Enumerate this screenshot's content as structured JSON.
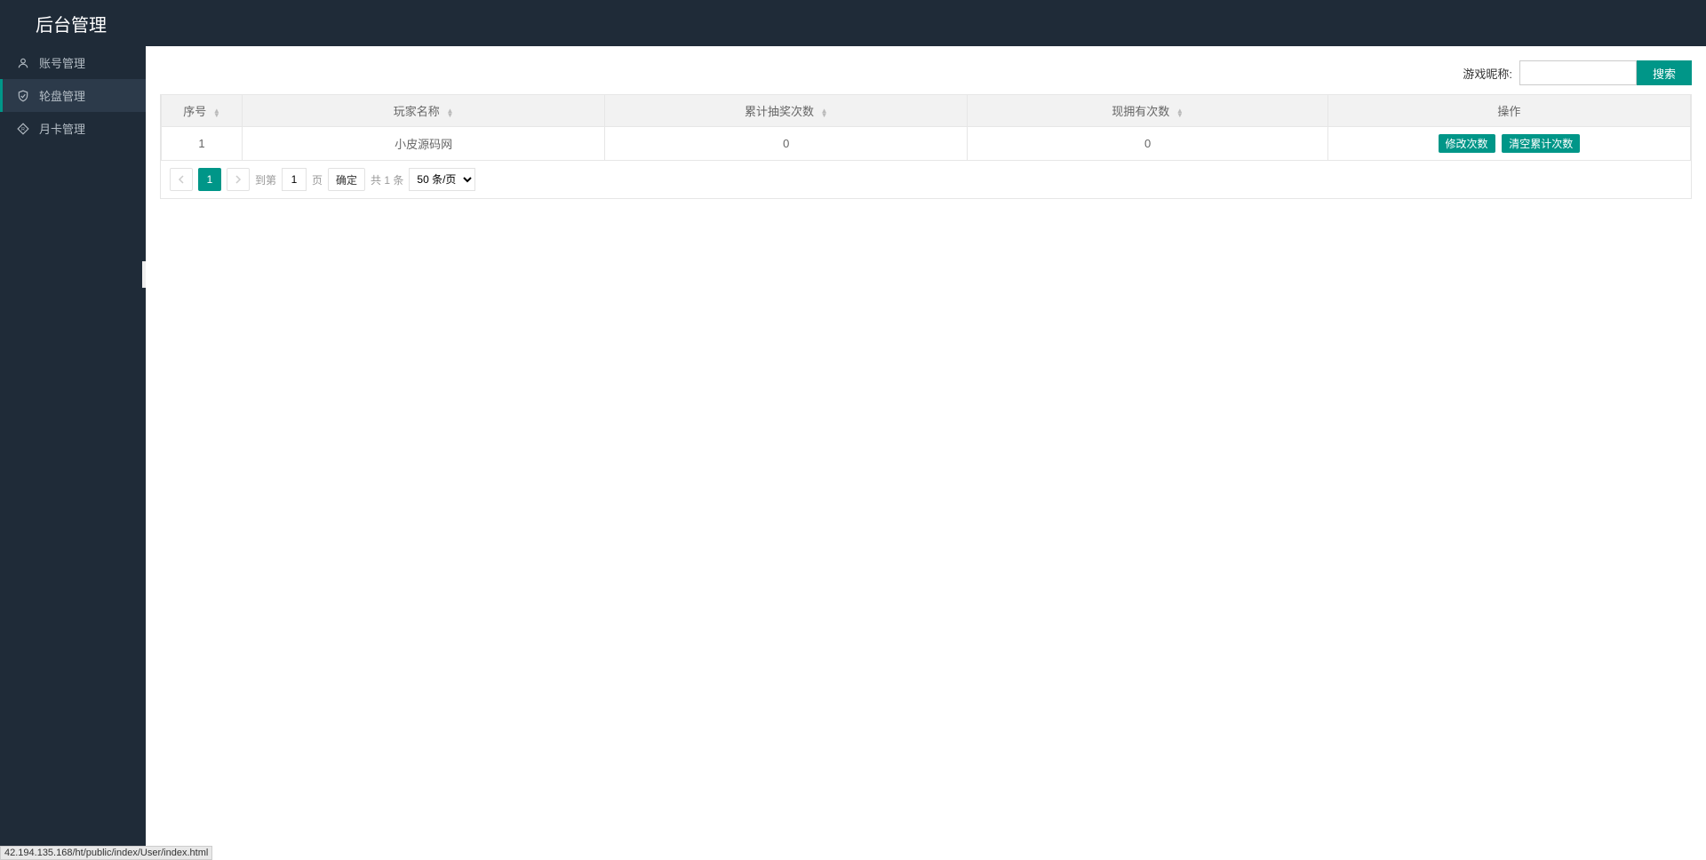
{
  "header": {
    "title": "后台管理"
  },
  "sidebar": {
    "items": [
      {
        "label": "账号管理",
        "icon": "user"
      },
      {
        "label": "轮盘管理",
        "icon": "shield"
      },
      {
        "label": "月卡管理",
        "icon": "diamond"
      }
    ]
  },
  "search": {
    "label": "游戏昵称:",
    "value": "",
    "button_label": "搜索"
  },
  "table": {
    "columns": [
      "序号",
      "玩家名称",
      "累计抽奖次数",
      "现拥有次数",
      "操作"
    ],
    "rows": [
      {
        "id": "1",
        "name": "小皮源码网",
        "total_draws": "0",
        "remaining": "0"
      }
    ],
    "actions": {
      "edit_label": "修改次数",
      "clear_label": "清空累计次数"
    }
  },
  "pagination": {
    "current_page": "1",
    "goto_label": "到第",
    "page_unit": "页",
    "page_input": "1",
    "confirm_label": "确定",
    "total_label": "共 1 条",
    "page_size": "50 条/页"
  },
  "status_bar": {
    "text": "42.194.135.168/ht/public/index/User/index.html"
  }
}
